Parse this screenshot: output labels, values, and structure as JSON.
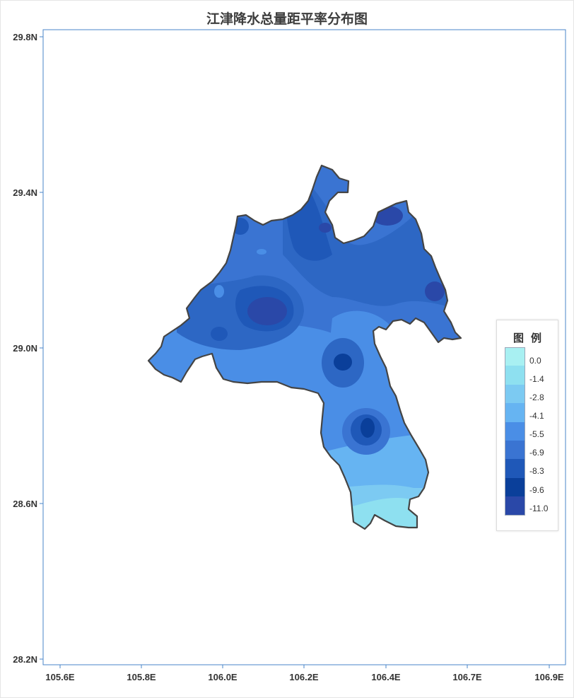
{
  "map": {
    "title": "江津降水总量距平率分布图",
    "y_ticks": [
      "29.8N",
      "29.4N",
      "29.0N",
      "28.6N",
      "28.2N"
    ],
    "x_ticks": [
      "105.6E",
      "105.8E",
      "106.0E",
      "106.2E",
      "106.4E",
      "106.7E",
      "106.9E"
    ],
    "axis_color": "#4a86c8",
    "outline_color": "#444444"
  },
  "legend": {
    "title": "图例",
    "items": [
      {
        "label": "0.0",
        "color": "#a8f0f2"
      },
      {
        "label": "-1.4",
        "color": "#8ee0f0"
      },
      {
        "label": "-2.8",
        "color": "#7ccaf2"
      },
      {
        "label": "-4.1",
        "color": "#66b4f2"
      },
      {
        "label": "-5.5",
        "color": "#4a8ee6"
      },
      {
        "label": "-6.9",
        "color": "#3a74d2"
      },
      {
        "label": "-8.3",
        "color": "#1f58b8"
      },
      {
        "label": "-9.6",
        "color": "#0a3f9a"
      },
      {
        "label": "-11.0",
        "color": "#2a48a8"
      }
    ]
  }
}
